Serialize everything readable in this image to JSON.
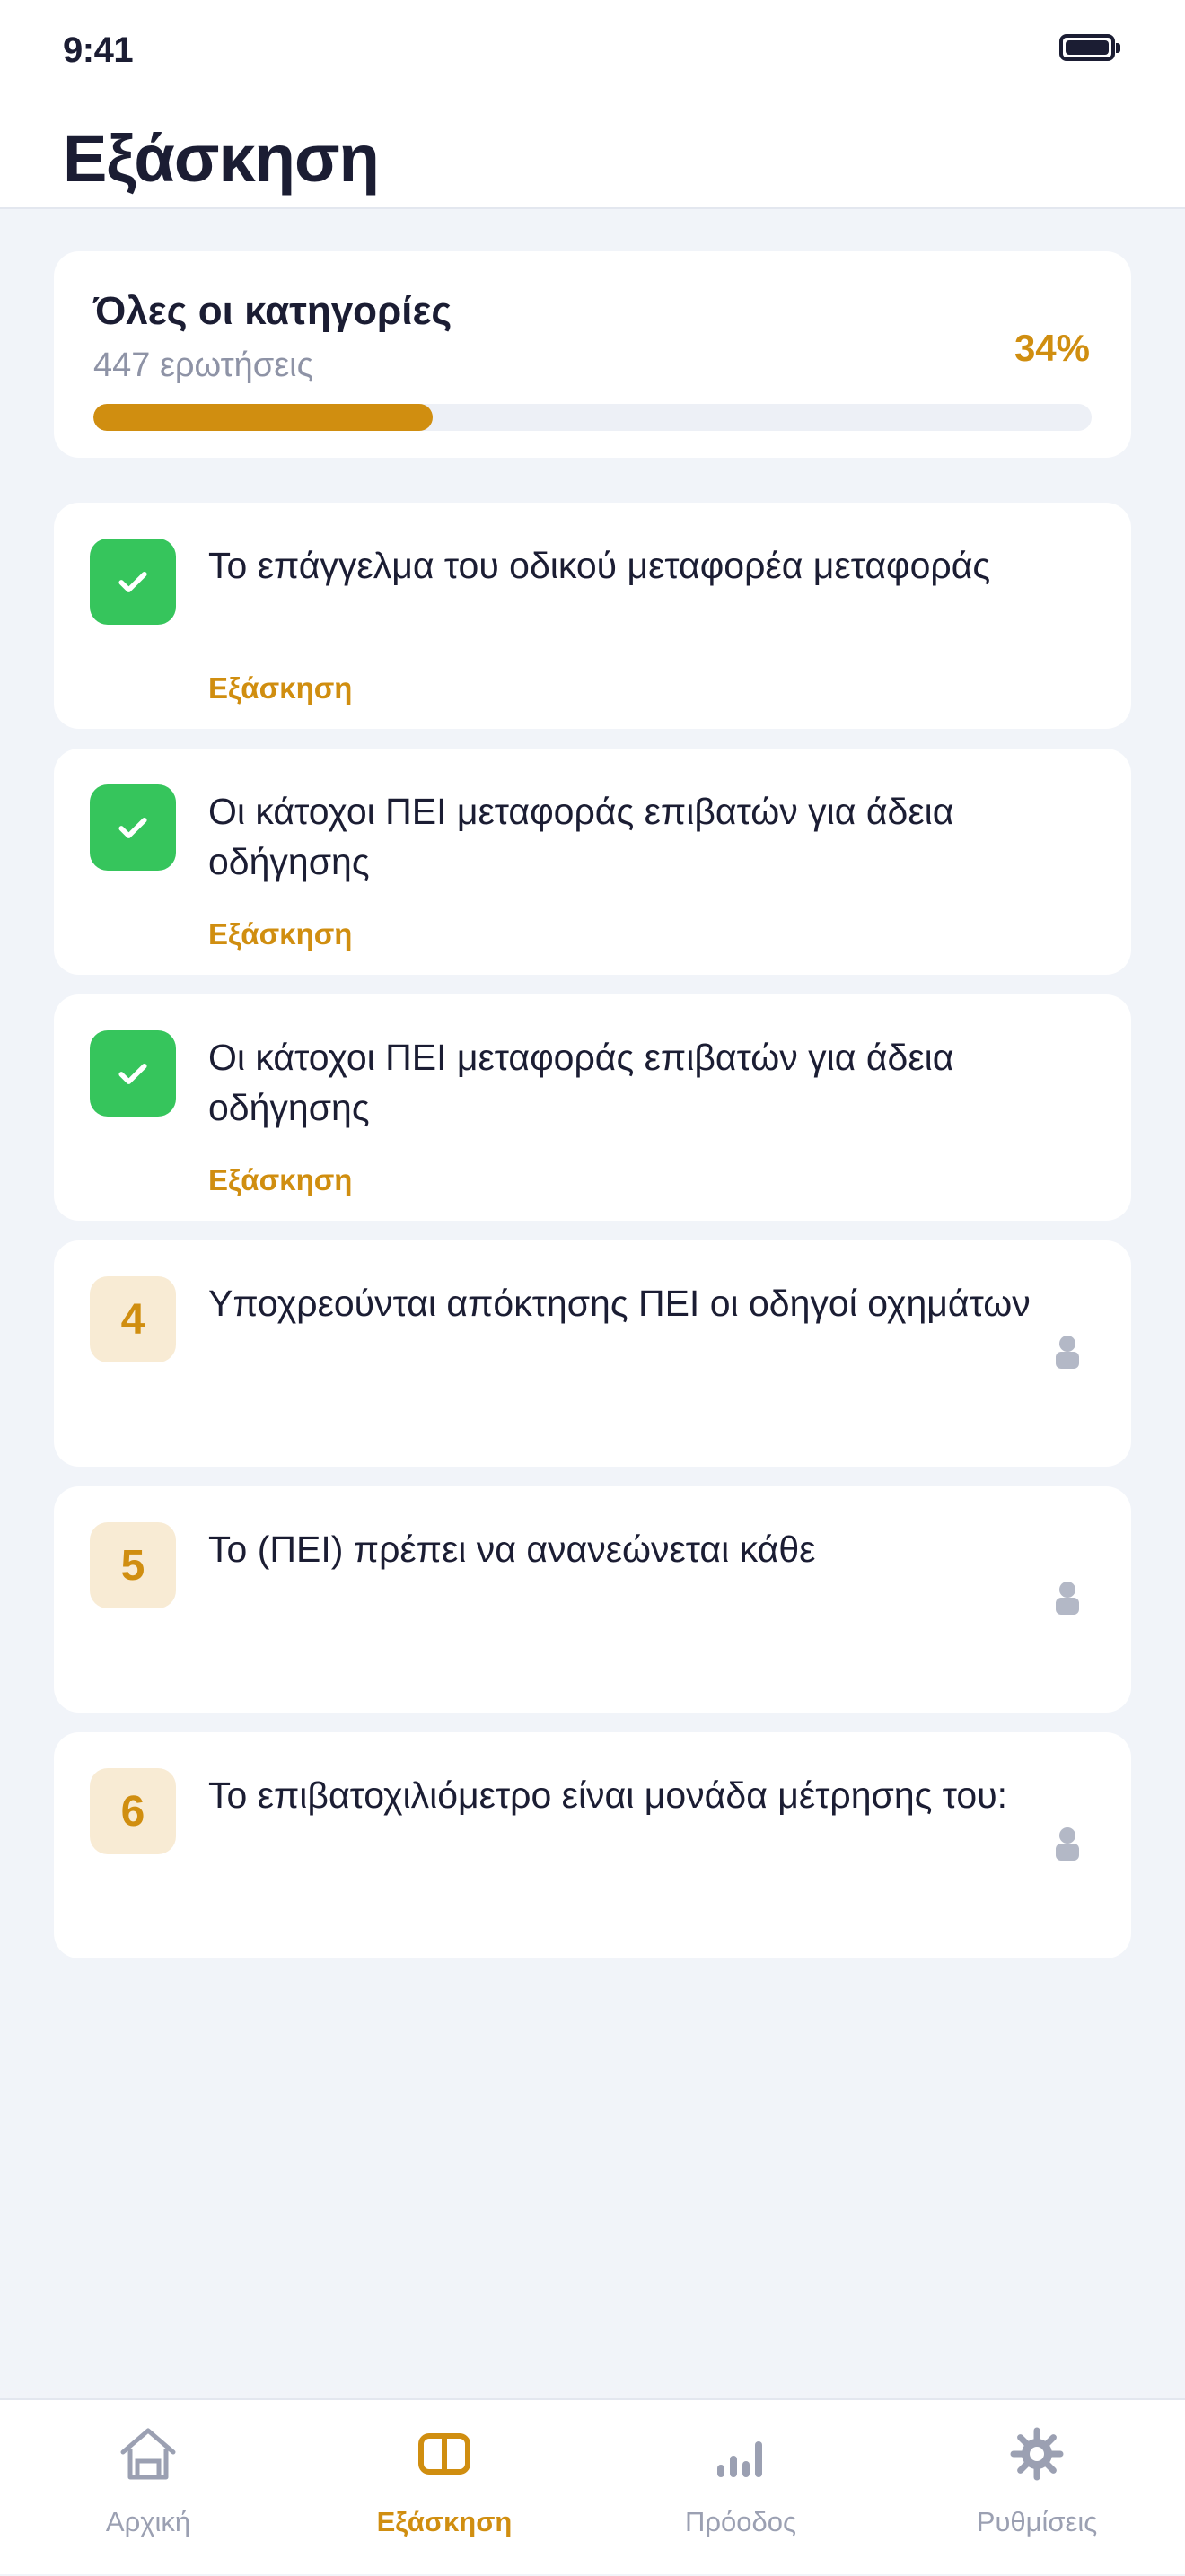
{
  "status_bar": {
    "time": "9:41"
  },
  "header": {
    "title": "Εξάσκηση"
  },
  "summary": {
    "title": "Όλες οι κατηγορίες",
    "subtitle": "447 ερωτήσεις",
    "percent_label": "34%",
    "progress_fraction": 0.34
  },
  "categories": [
    {
      "badge": "",
      "status": "completed",
      "title": "Το επάγγελμα του οδικού μεταφορέα μεταφοράς",
      "action": "Εξάσκηση"
    },
    {
      "badge": "",
      "status": "completed",
      "title": "Οι κάτοχοι ΠΕΙ μεταφοράς επιβατών για άδεια οδήγησης",
      "action": "Εξάσκηση"
    },
    {
      "badge": "",
      "status": "completed",
      "title": "Οι κάτοχοι ΠΕΙ μεταφοράς επιβατών για άδεια οδήγησης",
      "action": "Εξάσκηση"
    },
    {
      "badge": "4",
      "status": "locked",
      "title": "Υποχρεούνται απόκτησης ΠΕΙ οι οδηγοί οχημάτων",
      "action": ""
    },
    {
      "badge": "5",
      "status": "locked",
      "title": "Το (ΠΕΙ) πρέπει να ανανεώνεται κάθε",
      "action": ""
    },
    {
      "badge": "6",
      "status": "locked",
      "title": "Το επιβατοχιλιόμετρο είναι μονάδα μέτρησης του:",
      "action": ""
    }
  ],
  "tab_bar": {
    "tabs": [
      {
        "label": "Αρχική",
        "icon": "home-icon",
        "active": false
      },
      {
        "label": "Εξάσκηση",
        "icon": "book-icon",
        "active": true
      },
      {
        "label": "Πρόοδος",
        "icon": "bar-chart-icon",
        "active": false
      },
      {
        "label": "Ρυθμίσεις",
        "icon": "gear-icon",
        "active": false
      }
    ]
  },
  "colors": {
    "accent": "#d08e10",
    "success": "#36c55c",
    "background": "#f1f4f9",
    "text": "#1b1d33",
    "muted": "#9ba0b2"
  }
}
